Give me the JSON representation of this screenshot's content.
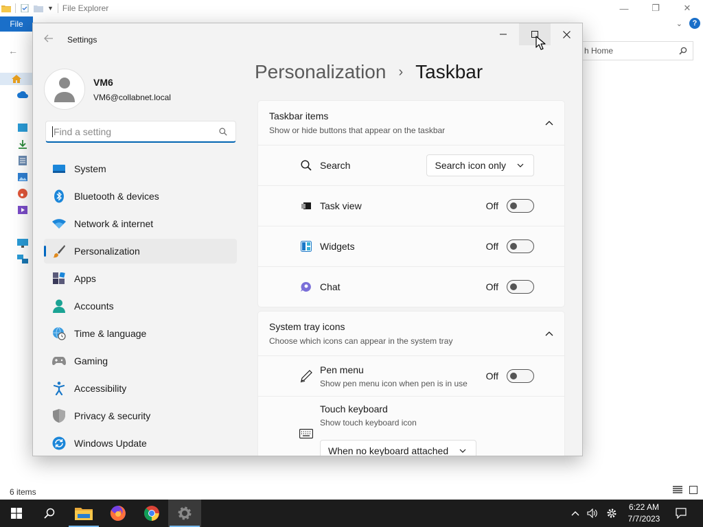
{
  "explorer": {
    "title": "File Explorer",
    "file_tab": "File",
    "search_placeholder": "h Home",
    "status": "6 items"
  },
  "settings": {
    "app_title": "Settings",
    "user": {
      "name": "VM6",
      "email": "VM6@collabnet.local"
    },
    "search_placeholder": "Find a setting",
    "nav": [
      {
        "label": "System",
        "icon": "system-icon"
      },
      {
        "label": "Bluetooth & devices",
        "icon": "bluetooth-icon"
      },
      {
        "label": "Network & internet",
        "icon": "wifi-icon"
      },
      {
        "label": "Personalization",
        "icon": "brush-icon",
        "active": true
      },
      {
        "label": "Apps",
        "icon": "apps-icon"
      },
      {
        "label": "Accounts",
        "icon": "person-icon"
      },
      {
        "label": "Time & language",
        "icon": "globe-clock-icon"
      },
      {
        "label": "Gaming",
        "icon": "gamepad-icon"
      },
      {
        "label": "Accessibility",
        "icon": "accessibility-icon"
      },
      {
        "label": "Privacy & security",
        "icon": "shield-icon"
      },
      {
        "label": "Windows Update",
        "icon": "update-icon"
      }
    ],
    "breadcrumb": {
      "parent": "Personalization",
      "current": "Taskbar"
    },
    "taskbar_items": {
      "title": "Taskbar items",
      "subtitle": "Show or hide buttons that appear on the taskbar",
      "search": {
        "label": "Search",
        "value": "Search icon only"
      },
      "task_view": {
        "label": "Task view",
        "state": "Off"
      },
      "widgets": {
        "label": "Widgets",
        "state": "Off"
      },
      "chat": {
        "label": "Chat",
        "state": "Off"
      }
    },
    "system_tray": {
      "title": "System tray icons",
      "subtitle": "Choose which icons can appear in the system tray",
      "pen_menu": {
        "label": "Pen menu",
        "description": "Show pen menu icon when pen is in use",
        "state": "Off"
      },
      "touch_keyboard": {
        "label": "Touch keyboard",
        "description": "Show touch keyboard icon",
        "value": "When no keyboard attached"
      }
    }
  },
  "taskbar": {
    "time": "6:22 AM",
    "date": "7/7/2023"
  },
  "colors": {
    "accent": "#0067c0",
    "taskbar_bg": "#1c1c1c",
    "explorer_file_tab": "#1a6fc9"
  }
}
